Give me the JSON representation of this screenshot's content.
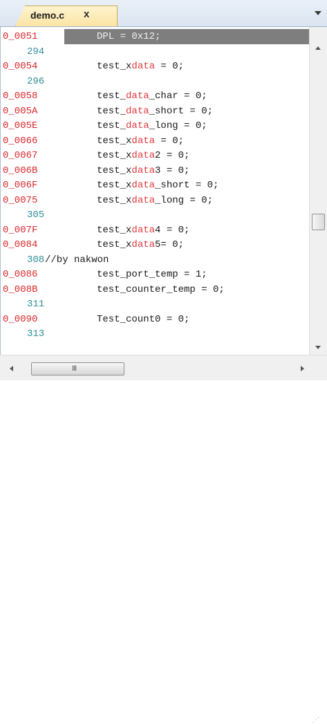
{
  "tab": {
    "label": "demo.c",
    "close_symbol": "x"
  },
  "lines": [
    {
      "addr": "0_0051",
      "num": "",
      "code": [
        {
          "t": "DPL = 0x12;",
          "k": false
        }
      ],
      "selected": true
    },
    {
      "addr": "",
      "num": "294",
      "code": []
    },
    {
      "addr": "0_0054",
      "num": "",
      "code": [
        {
          "t": "test_",
          "k": false
        },
        {
          "t": "x",
          "k": false
        },
        {
          "t": "data",
          "k": true
        },
        {
          "t": " = 0;",
          "k": false
        }
      ]
    },
    {
      "addr": "",
      "num": "296",
      "code": []
    },
    {
      "addr": "0_0058",
      "num": "",
      "code": [
        {
          "t": "test_",
          "k": false
        },
        {
          "t": "data",
          "k": true
        },
        {
          "t": "_char = 0;",
          "k": false
        }
      ]
    },
    {
      "addr": "0_005A",
      "num": "",
      "code": [
        {
          "t": "test_",
          "k": false
        },
        {
          "t": "data",
          "k": true
        },
        {
          "t": "_short = 0;",
          "k": false
        }
      ]
    },
    {
      "addr": "0_005E",
      "num": "",
      "code": [
        {
          "t": "test_",
          "k": false
        },
        {
          "t": "data",
          "k": true
        },
        {
          "t": "_long = 0;",
          "k": false
        }
      ]
    },
    {
      "addr": "0_0066",
      "num": "",
      "code": [
        {
          "t": "test_x",
          "k": false
        },
        {
          "t": "data",
          "k": true
        },
        {
          "t": " = 0;",
          "k": false
        }
      ]
    },
    {
      "addr": "0_0067",
      "num": "",
      "code": [
        {
          "t": "test_x",
          "k": false
        },
        {
          "t": "data",
          "k": true
        },
        {
          "t": "2 = 0;",
          "k": false
        }
      ]
    },
    {
      "addr": "0_006B",
      "num": "",
      "code": [
        {
          "t": "test_x",
          "k": false
        },
        {
          "t": "data",
          "k": true
        },
        {
          "t": "3 = 0;",
          "k": false
        }
      ]
    },
    {
      "addr": "0_006F",
      "num": "",
      "code": [
        {
          "t": "test_x",
          "k": false
        },
        {
          "t": "data",
          "k": true
        },
        {
          "t": "_short = 0;",
          "k": false
        }
      ]
    },
    {
      "addr": "0_0075",
      "num": "",
      "code": [
        {
          "t": "test_x",
          "k": false
        },
        {
          "t": "data",
          "k": true
        },
        {
          "t": "_long = 0;",
          "k": false
        }
      ]
    },
    {
      "addr": "",
      "num": "305",
      "code": []
    },
    {
      "addr": "0_007F",
      "num": "",
      "code": [
        {
          "t": "test_x",
          "k": false
        },
        {
          "t": "data",
          "k": true
        },
        {
          "t": "4 = 0;",
          "k": false
        }
      ]
    },
    {
      "addr": "0_0084",
      "num": "",
      "code": [
        {
          "t": "test_x",
          "k": false
        },
        {
          "t": "data",
          "k": true
        },
        {
          "t": "5= 0;",
          "k": false
        }
      ]
    },
    {
      "addr": "",
      "num": "308",
      "code": [
        {
          "t": "//by nakwon",
          "k": false
        }
      ],
      "comment": true
    },
    {
      "addr": "0_0086",
      "num": "",
      "code": [
        {
          "t": "test_port_temp = 1;",
          "k": false
        }
      ]
    },
    {
      "addr": "0_008B",
      "num": "",
      "code": [
        {
          "t": "test_counter_temp = 0;",
          "k": false
        }
      ]
    },
    {
      "addr": "",
      "num": "311",
      "code": []
    },
    {
      "addr": "0_0090",
      "num": "",
      "code": [
        {
          "t": "Test_count0 = 0;",
          "k": false
        }
      ]
    },
    {
      "addr": "",
      "num": "313",
      "code": []
    }
  ],
  "hscroll": {
    "grip": "III"
  },
  "colors": {
    "address": "#d8282c",
    "line_number": "#2f8f9a",
    "keyword": "#e0383c",
    "selection": "#7e7e7e",
    "tab": "#fbe4a3"
  }
}
